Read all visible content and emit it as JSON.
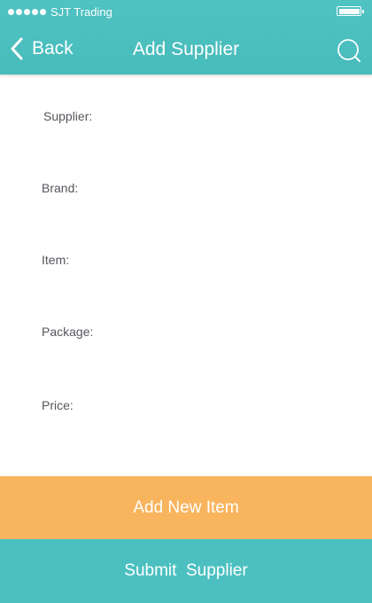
{
  "status_bar": {
    "carrier": "SJT Trading",
    "signal_bars": 5,
    "battery_level": 1.0,
    "signal_icon": "signal-dots-icon",
    "battery_icon": "battery-icon"
  },
  "header": {
    "back_label": "Back",
    "back_icon": "chevron-left-icon",
    "title": "Add Supplier",
    "search_icon": "search-icon",
    "background_color": "#4cc0c0"
  },
  "form": {
    "fields": [
      {
        "label": "Supplier:",
        "value": "",
        "placeholder": ""
      },
      {
        "label": "Brand:",
        "value": "",
        "placeholder": ""
      },
      {
        "label": "Item:",
        "value": "",
        "placeholder": ""
      },
      {
        "label": "Package:",
        "value": "",
        "placeholder": ""
      },
      {
        "label": "Price:",
        "value": "",
        "placeholder": ""
      }
    ]
  },
  "actions": {
    "add_item_label": "Add New Item",
    "add_item_color": "#f9b45e",
    "submit_label": "Submit  Supplier",
    "submit_color": "#4cc0c0"
  }
}
